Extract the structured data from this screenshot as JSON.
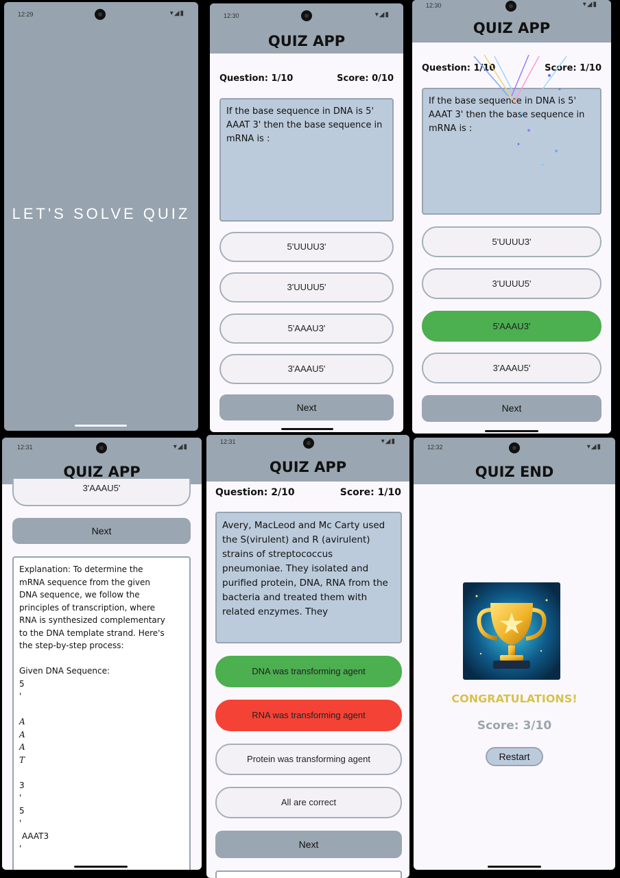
{
  "splash": {
    "status_time": "12:29",
    "title": "LET'S SOLVE QUIZ"
  },
  "app_title": "QUIZ APP",
  "q1_screen": {
    "status_time": "12:30",
    "question_label": "Question: 1/10",
    "score_label": "Score: 0/10",
    "question": "If the base sequence in DNA is 5' AAAT 3' then the base sequence in mRNA is :",
    "options": [
      "5'UUUU3'",
      "3'UUUU5'",
      "5'AAAU3'",
      "3'AAAU5'"
    ],
    "next_label": "Next"
  },
  "q1_answered": {
    "status_time": "12:30",
    "question_label": "Question: 1/10",
    "score_label": "Score: 1/10",
    "question": "If the base sequence in DNA is 5' AAAT 3' then the base sequence in mRNA is :",
    "options": [
      "5'UUUU3'",
      "3'UUUU5'",
      "5'AAAU3'",
      "3'AAAU5'"
    ],
    "correct_index": 2,
    "correct_color": "#4caf50",
    "next_label": "Next"
  },
  "explanation_screen": {
    "status_time": "12:31",
    "last_option": "3'AAAU5'",
    "next_label": "Next",
    "explanation_lines": [
      "Explanation: To determine the",
      "mRNA sequence from the given",
      "DNA sequence, we follow the",
      "principles of transcription, where",
      "RNA is synthesized complementary",
      "to the DNA template strand. Here's",
      "the step-by-step process:",
      "",
      "Given DNA Sequence:",
      "5",
      "'",
      "",
      "A",
      "A",
      "A",
      "T",
      "",
      "3",
      "'",
      "5",
      "'",
      " AAAT3",
      "'"
    ]
  },
  "q2_screen": {
    "status_time": "12:31",
    "question_label": "Question: 2/10",
    "score_label": "Score: 1/10",
    "question": "Avery, MacLeod and Mc Carty used the S(virulent) and R (avirulent) strains of streptococcus pneumoniae. They isolated and purified protein, DNA, RNA from the bacteria and treated them with related enzymes. They",
    "options": [
      "DNA was transforming agent",
      "RNA was transforming agent",
      "Protein was transforming agent",
      "All are correct"
    ],
    "correct_index": 0,
    "wrong_index": 1,
    "correct_color": "#4caf50",
    "wrong_color": "#f44336",
    "next_label": "Next"
  },
  "end_screen": {
    "status_time": "12:32",
    "title": "QUIZ END",
    "congrats": "CONGRATULATIONS!",
    "score": "Score: 3/10",
    "restart_label": "Restart",
    "congrats_color": "#d6c24a",
    "score_color": "#9aa4ad",
    "trophy_icon": "trophy-icon"
  }
}
